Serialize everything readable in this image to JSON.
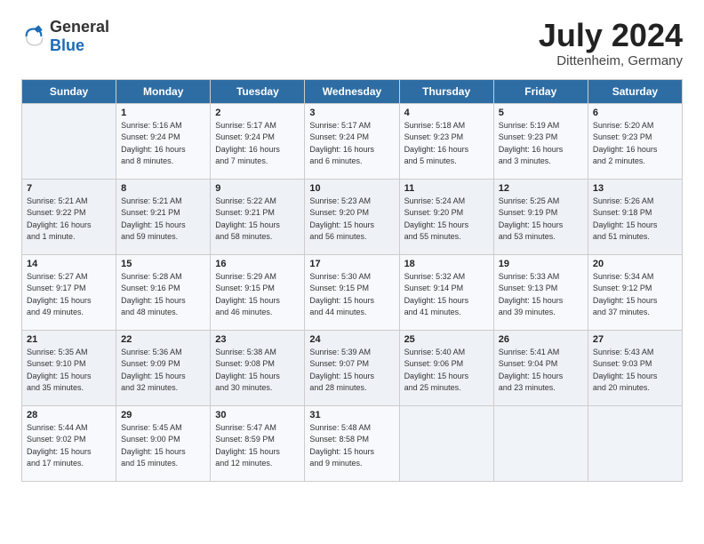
{
  "logo": {
    "general": "General",
    "blue": "Blue"
  },
  "title": {
    "month_year": "July 2024",
    "location": "Dittenheim, Germany"
  },
  "headers": [
    "Sunday",
    "Monday",
    "Tuesday",
    "Wednesday",
    "Thursday",
    "Friday",
    "Saturday"
  ],
  "weeks": [
    [
      {
        "day": "",
        "info": ""
      },
      {
        "day": "1",
        "info": "Sunrise: 5:16 AM\nSunset: 9:24 PM\nDaylight: 16 hours\nand 8 minutes."
      },
      {
        "day": "2",
        "info": "Sunrise: 5:17 AM\nSunset: 9:24 PM\nDaylight: 16 hours\nand 7 minutes."
      },
      {
        "day": "3",
        "info": "Sunrise: 5:17 AM\nSunset: 9:24 PM\nDaylight: 16 hours\nand 6 minutes."
      },
      {
        "day": "4",
        "info": "Sunrise: 5:18 AM\nSunset: 9:23 PM\nDaylight: 16 hours\nand 5 minutes."
      },
      {
        "day": "5",
        "info": "Sunrise: 5:19 AM\nSunset: 9:23 PM\nDaylight: 16 hours\nand 3 minutes."
      },
      {
        "day": "6",
        "info": "Sunrise: 5:20 AM\nSunset: 9:23 PM\nDaylight: 16 hours\nand 2 minutes."
      }
    ],
    [
      {
        "day": "7",
        "info": "Sunrise: 5:21 AM\nSunset: 9:22 PM\nDaylight: 16 hours\nand 1 minute."
      },
      {
        "day": "8",
        "info": "Sunrise: 5:21 AM\nSunset: 9:21 PM\nDaylight: 15 hours\nand 59 minutes."
      },
      {
        "day": "9",
        "info": "Sunrise: 5:22 AM\nSunset: 9:21 PM\nDaylight: 15 hours\nand 58 minutes."
      },
      {
        "day": "10",
        "info": "Sunrise: 5:23 AM\nSunset: 9:20 PM\nDaylight: 15 hours\nand 56 minutes."
      },
      {
        "day": "11",
        "info": "Sunrise: 5:24 AM\nSunset: 9:20 PM\nDaylight: 15 hours\nand 55 minutes."
      },
      {
        "day": "12",
        "info": "Sunrise: 5:25 AM\nSunset: 9:19 PM\nDaylight: 15 hours\nand 53 minutes."
      },
      {
        "day": "13",
        "info": "Sunrise: 5:26 AM\nSunset: 9:18 PM\nDaylight: 15 hours\nand 51 minutes."
      }
    ],
    [
      {
        "day": "14",
        "info": "Sunrise: 5:27 AM\nSunset: 9:17 PM\nDaylight: 15 hours\nand 49 minutes."
      },
      {
        "day": "15",
        "info": "Sunrise: 5:28 AM\nSunset: 9:16 PM\nDaylight: 15 hours\nand 48 minutes."
      },
      {
        "day": "16",
        "info": "Sunrise: 5:29 AM\nSunset: 9:15 PM\nDaylight: 15 hours\nand 46 minutes."
      },
      {
        "day": "17",
        "info": "Sunrise: 5:30 AM\nSunset: 9:15 PM\nDaylight: 15 hours\nand 44 minutes."
      },
      {
        "day": "18",
        "info": "Sunrise: 5:32 AM\nSunset: 9:14 PM\nDaylight: 15 hours\nand 41 minutes."
      },
      {
        "day": "19",
        "info": "Sunrise: 5:33 AM\nSunset: 9:13 PM\nDaylight: 15 hours\nand 39 minutes."
      },
      {
        "day": "20",
        "info": "Sunrise: 5:34 AM\nSunset: 9:12 PM\nDaylight: 15 hours\nand 37 minutes."
      }
    ],
    [
      {
        "day": "21",
        "info": "Sunrise: 5:35 AM\nSunset: 9:10 PM\nDaylight: 15 hours\nand 35 minutes."
      },
      {
        "day": "22",
        "info": "Sunrise: 5:36 AM\nSunset: 9:09 PM\nDaylight: 15 hours\nand 32 minutes."
      },
      {
        "day": "23",
        "info": "Sunrise: 5:38 AM\nSunset: 9:08 PM\nDaylight: 15 hours\nand 30 minutes."
      },
      {
        "day": "24",
        "info": "Sunrise: 5:39 AM\nSunset: 9:07 PM\nDaylight: 15 hours\nand 28 minutes."
      },
      {
        "day": "25",
        "info": "Sunrise: 5:40 AM\nSunset: 9:06 PM\nDaylight: 15 hours\nand 25 minutes."
      },
      {
        "day": "26",
        "info": "Sunrise: 5:41 AM\nSunset: 9:04 PM\nDaylight: 15 hours\nand 23 minutes."
      },
      {
        "day": "27",
        "info": "Sunrise: 5:43 AM\nSunset: 9:03 PM\nDaylight: 15 hours\nand 20 minutes."
      }
    ],
    [
      {
        "day": "28",
        "info": "Sunrise: 5:44 AM\nSunset: 9:02 PM\nDaylight: 15 hours\nand 17 minutes."
      },
      {
        "day": "29",
        "info": "Sunrise: 5:45 AM\nSunset: 9:00 PM\nDaylight: 15 hours\nand 15 minutes."
      },
      {
        "day": "30",
        "info": "Sunrise: 5:47 AM\nSunset: 8:59 PM\nDaylight: 15 hours\nand 12 minutes."
      },
      {
        "day": "31",
        "info": "Sunrise: 5:48 AM\nSunset: 8:58 PM\nDaylight: 15 hours\nand 9 minutes."
      },
      {
        "day": "",
        "info": ""
      },
      {
        "day": "",
        "info": ""
      },
      {
        "day": "",
        "info": ""
      }
    ]
  ]
}
